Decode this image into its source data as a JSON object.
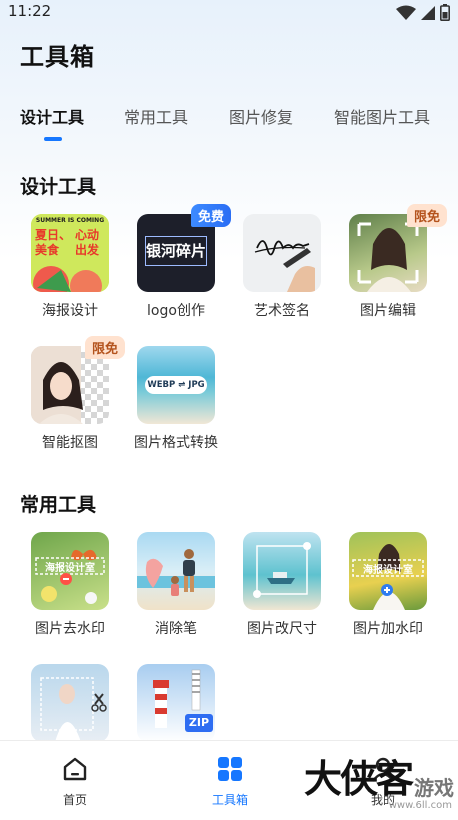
{
  "status": {
    "time": "11:22"
  },
  "page": {
    "title": "工具箱"
  },
  "tabs": [
    {
      "label": "设计工具",
      "active": true
    },
    {
      "label": "常用工具",
      "active": false
    },
    {
      "label": "图片修复",
      "active": false
    },
    {
      "label": "智能图片工具",
      "active": false
    }
  ],
  "sections": {
    "design": {
      "title": "设计工具",
      "items": [
        {
          "label": "海报设计",
          "poster_lines": [
            "SUMMER IS COMING",
            "夏日、",
            "心动",
            "美食",
            "出发"
          ]
        },
        {
          "label": "logo创作",
          "badge": "免费",
          "tile_text": "银河碎片"
        },
        {
          "label": "艺术签名"
        },
        {
          "label": "图片编辑",
          "badge": "限免"
        },
        {
          "label": "智能抠图",
          "badge": "限免"
        },
        {
          "label": "图片格式转换",
          "tile_text": "WEBP ⇌ JPG"
        }
      ]
    },
    "common": {
      "title": "常用工具",
      "items": [
        {
          "label": "图片去水印",
          "tile_text": "海报设计室"
        },
        {
          "label": "消除笔"
        },
        {
          "label": "图片改尺寸"
        },
        {
          "label": "图片加水印",
          "tile_text": "海报设计室"
        },
        {
          "label": ""
        },
        {
          "label": "",
          "tile_text": "ZIP"
        }
      ]
    }
  },
  "bottom_nav": [
    {
      "label": "首页",
      "icon": "home-icon",
      "active": false
    },
    {
      "label": "工具箱",
      "icon": "grid-icon",
      "active": true
    },
    {
      "label": "我的",
      "icon": "user-icon",
      "active": false
    }
  ],
  "watermark": {
    "main": "大侠客",
    "sub": "游戏",
    "url": "www.6ll.com"
  },
  "colors": {
    "accent": "#1677ff",
    "badge_limited_bg": "#ffe2cf",
    "badge_limited_fg": "#b4531d"
  }
}
